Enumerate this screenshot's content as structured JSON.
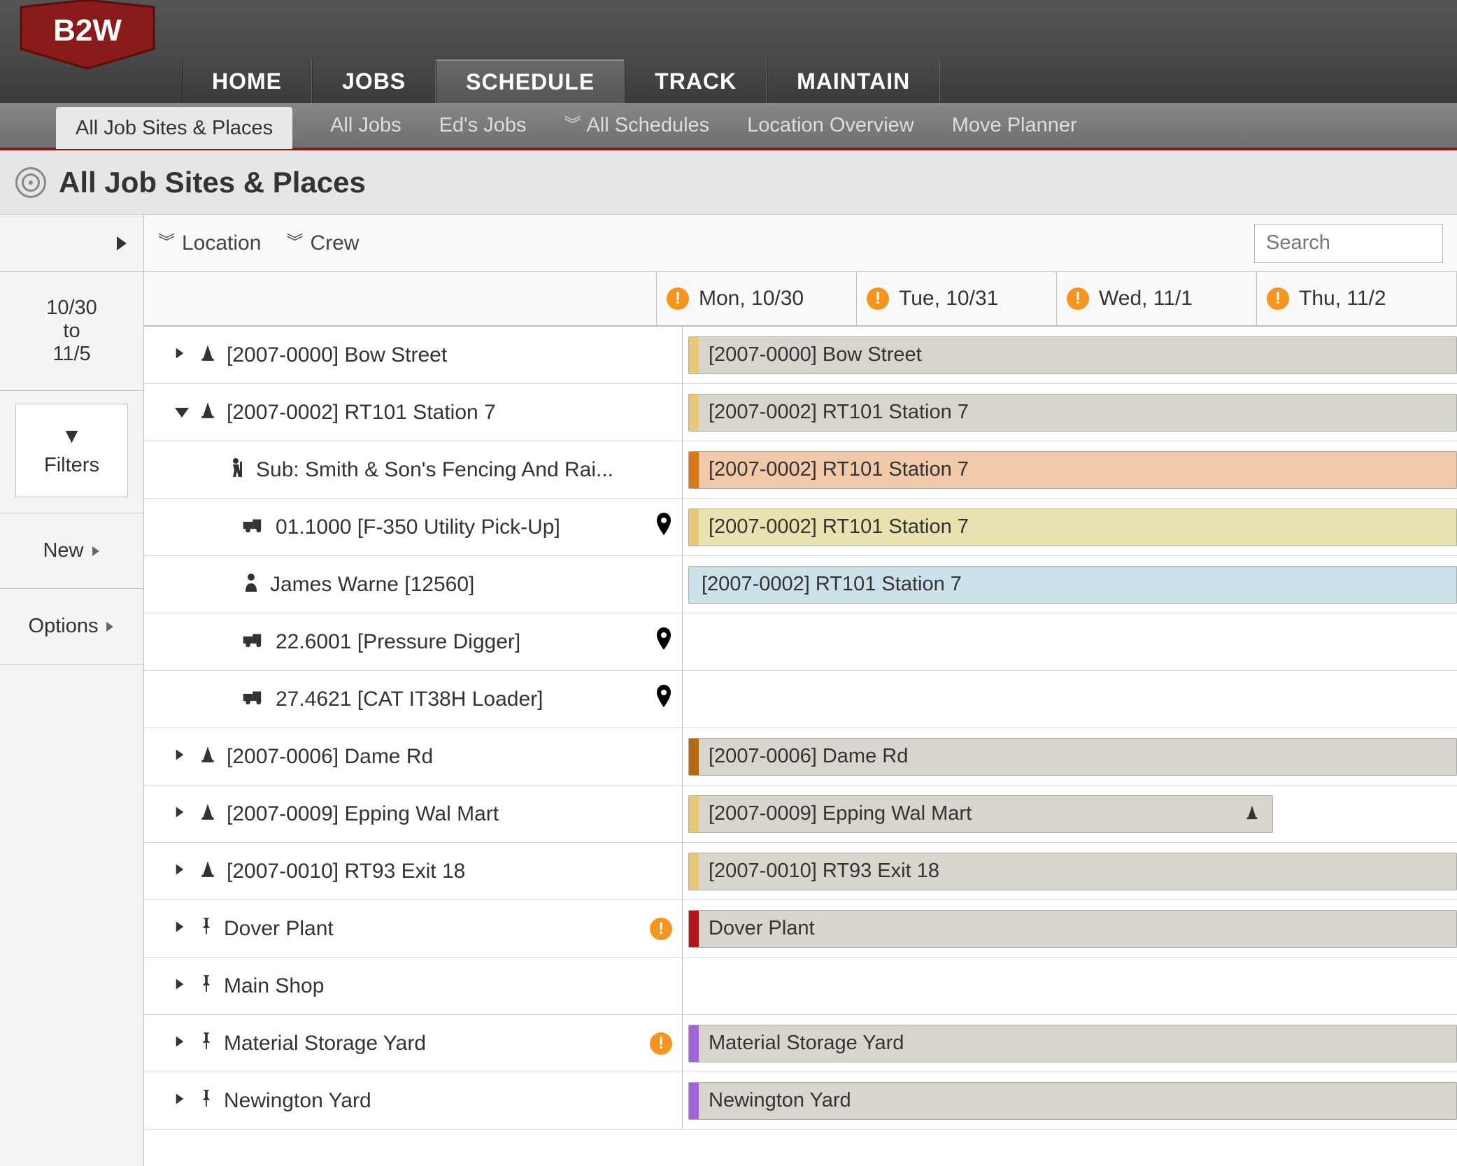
{
  "nav": {
    "home": "HOME",
    "jobs": "JOBS",
    "schedule": "SCHEDULE",
    "track": "TRACK",
    "maintain": "MAINTAIN"
  },
  "subnav": {
    "all_sites": "All Job Sites & Places",
    "all_jobs": "All Jobs",
    "eds_jobs": "Ed's Jobs",
    "all_schedules": "All Schedules",
    "location_overview": "Location Overview",
    "move_planner": "Move Planner"
  },
  "page": {
    "title": "All Job Sites & Places"
  },
  "toolbar": {
    "location": "Location",
    "crew": "Crew",
    "search_placeholder": "Search"
  },
  "sidebar": {
    "date_from": "10/30",
    "date_to": "to",
    "date_end": "11/5",
    "filters": "Filters",
    "new": "New",
    "options": "Options"
  },
  "days": [
    {
      "label": "Mon, 10/30"
    },
    {
      "label": "Tue, 10/31"
    },
    {
      "label": "Wed, 11/1"
    },
    {
      "label": "Thu, 11/2"
    }
  ],
  "rows": [
    {
      "type": "job",
      "depth": 1,
      "expanded": false,
      "icon": "cone",
      "label": "[2007-0000] Bow Street",
      "bar": {
        "text": "[2007-0000] Bow Street",
        "cls": "c-gray",
        "stripe": "s-tan",
        "full": true
      }
    },
    {
      "type": "job",
      "depth": 1,
      "expanded": true,
      "icon": "cone",
      "label": "[2007-0002] RT101 Station 7",
      "bar": {
        "text": "[2007-0002] RT101 Station 7",
        "cls": "c-gray",
        "stripe": "s-tan",
        "full": true
      }
    },
    {
      "type": "sub",
      "depth": 2,
      "icon": "worker",
      "label": "Sub: Smith & Son's Fencing And Rai...",
      "bar": {
        "text": "[2007-0002] RT101 Station 7",
        "cls": "c-orange",
        "stripe": "s-orange",
        "full": true
      }
    },
    {
      "type": "equip",
      "depth": 3,
      "icon": "truck",
      "label": "01.1000 [F-350 Utility Pick-Up]",
      "locpin": true,
      "bar": {
        "text": "[2007-0002] RT101 Station 7",
        "cls": "c-yellow",
        "stripe": "s-tan",
        "full": true
      }
    },
    {
      "type": "person",
      "depth": 3,
      "icon": "person",
      "label": "James Warne [12560]",
      "bar": {
        "text": "[2007-0002] RT101 Station 7",
        "cls": "c-blue",
        "stripe": "",
        "full": true
      }
    },
    {
      "type": "equip",
      "depth": 3,
      "icon": "truck",
      "label": "22.6001 [Pressure Digger]",
      "locpin": true,
      "bar": null
    },
    {
      "type": "equip",
      "depth": 3,
      "icon": "truck",
      "label": "27.4621 [CAT IT38H Loader]",
      "locpin": true,
      "bar": null
    },
    {
      "type": "job",
      "depth": 1,
      "expanded": false,
      "icon": "cone",
      "label": "[2007-0006] Dame Rd",
      "bar": {
        "text": "[2007-0006] Dame Rd",
        "cls": "c-gray",
        "stripe": "s-brown",
        "full": true
      }
    },
    {
      "type": "job",
      "depth": 1,
      "expanded": false,
      "icon": "cone",
      "label": "[2007-0009] Epping Wal Mart",
      "bar": {
        "text": "[2007-0009] Epping Wal Mart",
        "cls": "c-gray",
        "stripe": "s-tan",
        "full": false,
        "endicon": "cone"
      }
    },
    {
      "type": "job",
      "depth": 1,
      "expanded": false,
      "icon": "cone",
      "label": "[2007-0010] RT93 Exit 18",
      "bar": {
        "text": "[2007-0010] RT93 Exit 18",
        "cls": "c-gray",
        "stripe": "s-tan",
        "full": true
      }
    },
    {
      "type": "place",
      "depth": 1,
      "expanded": false,
      "icon": "pin",
      "label": "Dover Plant",
      "alert": true,
      "bar": {
        "text": "Dover Plant",
        "cls": "c-gray",
        "stripe": "s-red",
        "full": true
      }
    },
    {
      "type": "place",
      "depth": 1,
      "expanded": false,
      "icon": "pin",
      "label": "Main Shop",
      "bar": null
    },
    {
      "type": "place",
      "depth": 1,
      "expanded": false,
      "icon": "pin",
      "label": "Material Storage Yard",
      "alert": true,
      "bar": {
        "text": "Material Storage Yard",
        "cls": "c-gray",
        "stripe": "s-purple",
        "full": true
      }
    },
    {
      "type": "place",
      "depth": 1,
      "expanded": false,
      "icon": "pin",
      "label": "Newington Yard",
      "bar": {
        "text": "Newington Yard",
        "cls": "c-gray",
        "stripe": "s-purple",
        "full": true
      }
    }
  ],
  "icons": {
    "cone": "▲",
    "pin": "📌",
    "truck": "🚛",
    "worker": "🚧",
    "person": "👤",
    "loc": "📍"
  }
}
